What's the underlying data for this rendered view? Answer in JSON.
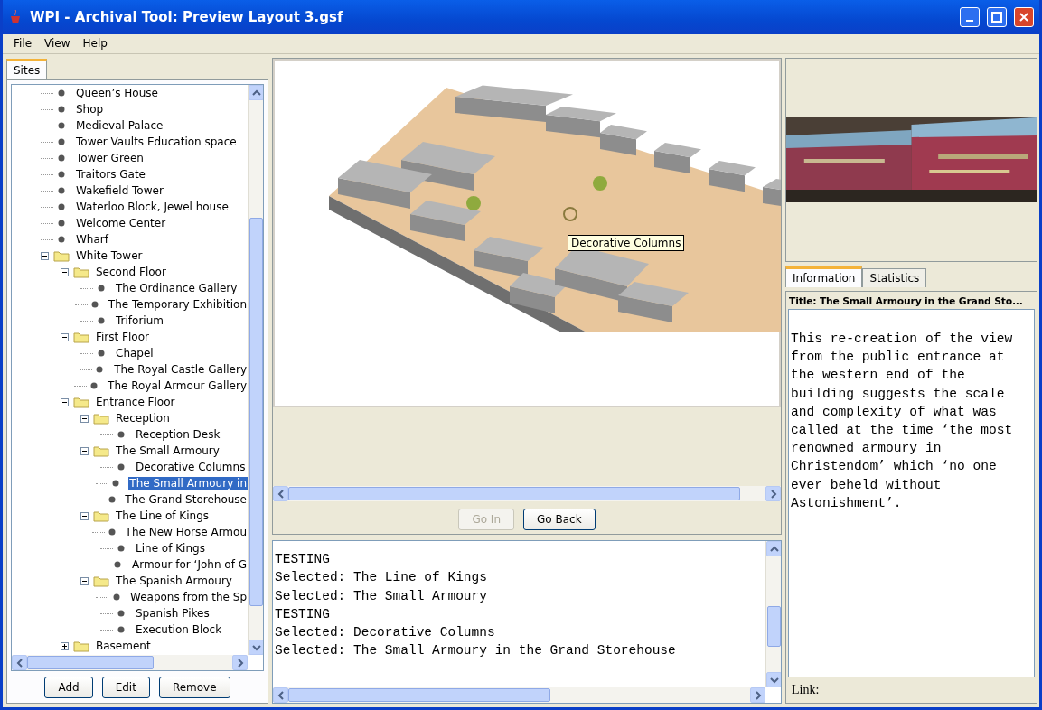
{
  "window": {
    "title": "WPI - Archival Tool: Preview Layout 3.gsf"
  },
  "menu": [
    "File",
    "View",
    "Help"
  ],
  "sites_panel": {
    "tabs": [
      {
        "label": "Sites",
        "selected": true
      }
    ],
    "tree": [
      {
        "label": "Queen’s House",
        "kind": "leaf",
        "selected": false
      },
      {
        "label": "Shop",
        "kind": "leaf",
        "selected": false
      },
      {
        "label": "Medieval Palace",
        "kind": "leaf",
        "selected": false
      },
      {
        "label": "Tower Vaults Education space",
        "kind": "leaf",
        "selected": false
      },
      {
        "label": "Tower Green",
        "kind": "leaf",
        "selected": false
      },
      {
        "label": "Traitors Gate",
        "kind": "leaf",
        "selected": false
      },
      {
        "label": "Wakefield Tower",
        "kind": "leaf",
        "selected": false
      },
      {
        "label": "Waterloo Block, Jewel house",
        "kind": "leaf",
        "selected": false
      },
      {
        "label": "Welcome Center",
        "kind": "leaf",
        "selected": false
      },
      {
        "label": "Wharf",
        "kind": "leaf",
        "selected": false
      },
      {
        "label": "White Tower",
        "kind": "folder",
        "expanded": true,
        "selected": false,
        "children": [
          {
            "label": "Second Floor",
            "kind": "folder",
            "expanded": true,
            "selected": false,
            "children": [
              {
                "label": "The Ordinance Gallery",
                "kind": "leaf",
                "selected": false
              },
              {
                "label": "The Temporary Exhibition",
                "kind": "leaf",
                "selected": false
              },
              {
                "label": "Triforium",
                "kind": "leaf",
                "selected": false
              }
            ]
          },
          {
            "label": "First Floor",
            "kind": "folder",
            "expanded": true,
            "selected": false,
            "children": [
              {
                "label": "Chapel",
                "kind": "leaf",
                "selected": false
              },
              {
                "label": "The Royal Castle Gallery",
                "kind": "leaf",
                "selected": false
              },
              {
                "label": "The Royal Armour Gallery",
                "kind": "leaf",
                "selected": false
              }
            ]
          },
          {
            "label": "Entrance Floor",
            "kind": "folder",
            "expanded": true,
            "selected": false,
            "children": [
              {
                "label": "Reception",
                "kind": "folder",
                "expanded": true,
                "selected": false,
                "children": [
                  {
                    "label": "Reception Desk",
                    "kind": "leaf",
                    "selected": false
                  }
                ]
              },
              {
                "label": "The Small Armoury",
                "kind": "folder",
                "expanded": true,
                "selected": false,
                "children": [
                  {
                    "label": "Decorative Columns",
                    "kind": "leaf",
                    "selected": false
                  },
                  {
                    "label": "The Small Armoury in",
                    "kind": "leaf",
                    "selected": true
                  },
                  {
                    "label": "The Grand Storehouse",
                    "kind": "leaf",
                    "selected": false
                  }
                ]
              },
              {
                "label": "The Line of Kings",
                "kind": "folder",
                "expanded": true,
                "selected": false,
                "children": [
                  {
                    "label": "The New Horse Armou",
                    "kind": "leaf",
                    "selected": false
                  },
                  {
                    "label": "Line of Kings",
                    "kind": "leaf",
                    "selected": false
                  },
                  {
                    "label": "Armour for ‘John of G",
                    "kind": "leaf",
                    "selected": false
                  }
                ]
              },
              {
                "label": "The Spanish Armoury",
                "kind": "folder",
                "expanded": true,
                "selected": false,
                "children": [
                  {
                    "label": "Weapons from the Sp",
                    "kind": "leaf",
                    "selected": false
                  },
                  {
                    "label": "Spanish Pikes",
                    "kind": "leaf",
                    "selected": false
                  },
                  {
                    "label": "Execution Block",
                    "kind": "leaf",
                    "selected": false
                  }
                ]
              }
            ]
          },
          {
            "label": "Basement",
            "kind": "folder",
            "expanded": false,
            "selected": false
          }
        ]
      }
    ],
    "buttons": [
      "Add",
      "Edit",
      "Remove"
    ]
  },
  "viewer": {
    "tooltip": "Decorative Columns",
    "buttons": [
      {
        "label": "Go In",
        "disabled": true
      },
      {
        "label": "Go Back",
        "disabled": false
      }
    ]
  },
  "console": {
    "lines": [
      "TESTING",
      "Selected: The Line of Kings",
      "Selected: The Small Armoury",
      "TESTING",
      "Selected: Decorative Columns",
      "Selected: The Small Armoury in the Grand Storehouse"
    ]
  },
  "info_panel": {
    "tabs": [
      {
        "label": "Information",
        "selected": true
      },
      {
        "label": "Statistics",
        "selected": false
      }
    ],
    "title": "Title: The Small Armoury in the Grand Sto...",
    "text": "This re-creation of the view from the public entrance at the western end of the building suggests the scale and complexity of what was called at the time ‘the most renowned armoury in Christendom’ which ‘no one ever beheld without Astonishment’.",
    "link_label": "Link:"
  }
}
